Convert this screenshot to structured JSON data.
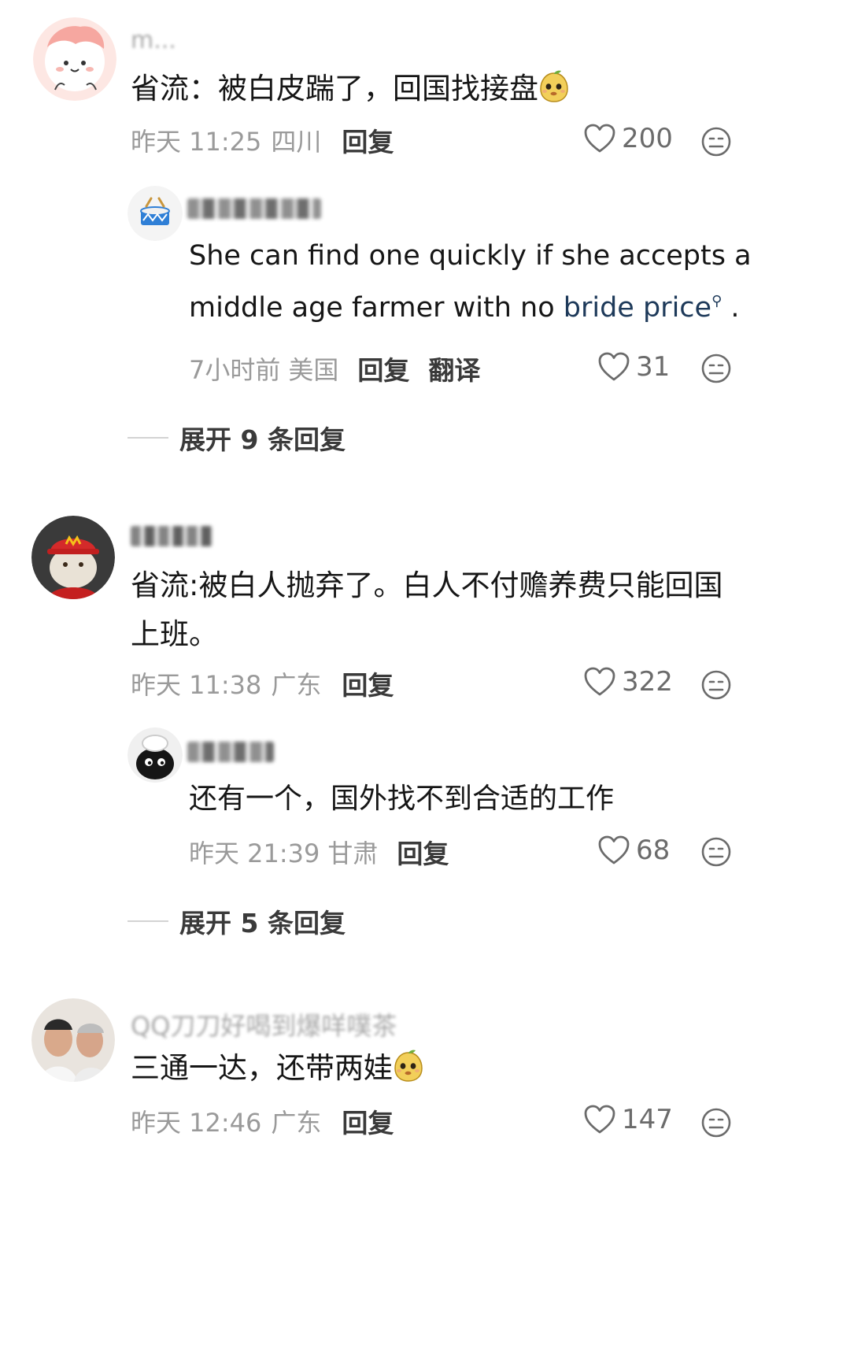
{
  "comments": [
    {
      "username": "m...",
      "text": "省流：被白皮踹了，回国找接盘",
      "time": "昨天 11:25",
      "location": "四川",
      "reply_label": "回复",
      "likes": "200",
      "reply": {
        "username": "",
        "text_line1": "She can find one quickly if she accepts a",
        "text_line2_pre": "middle age farmer with no ",
        "text_link": "bride price",
        "text_line2_post": " .",
        "time": "7小时前",
        "location": "美国",
        "reply_label": "回复",
        "translate_label": "翻译",
        "likes": "31"
      },
      "expand_label": "展开 9 条回复"
    },
    {
      "username": "",
      "text_line1": "省流:被白人抛弃了。白人不付赡养费只能回国",
      "text_line2": "上班。",
      "time": "昨天 11:38",
      "location": "广东",
      "reply_label": "回复",
      "likes": "322",
      "reply": {
        "username": "",
        "text": "还有一个，国外找不到合适的工作",
        "time": "昨天 21:39",
        "location": "甘肃",
        "reply_label": "回复",
        "likes": "68"
      },
      "expand_label": "展开 5 条回复"
    },
    {
      "username": "QQ刀刀好喝到爆咩噗茶",
      "text": "三通一达，还带两娃",
      "time": "昨天 12:46",
      "location": "广东",
      "reply_label": "回复",
      "likes": "147"
    }
  ],
  "colors": {
    "text": "#161616",
    "meta": "#9a9a9a",
    "link": "#1e3a5a",
    "background": "#ffffff"
  },
  "icons": [
    "heart-icon",
    "emoji-reaction-icon",
    "lemon-emoji"
  ]
}
